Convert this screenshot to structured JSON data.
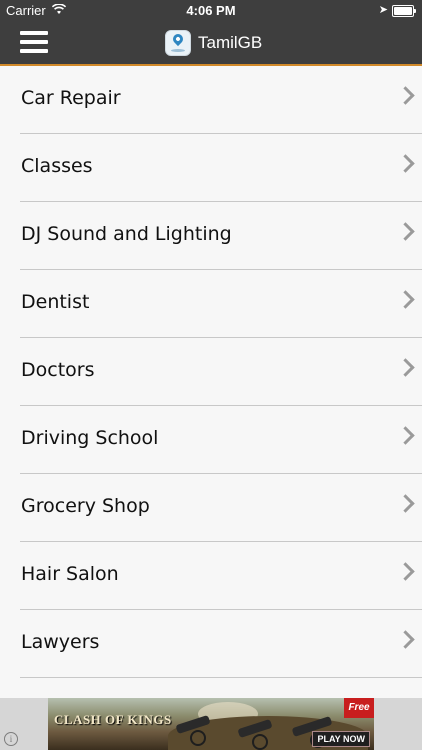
{
  "status_bar": {
    "carrier": "Carrier",
    "time": "4:06 PM",
    "wifi_icon": "wifi-icon",
    "location_icon": "location-arrow-icon",
    "battery_icon": "battery-icon"
  },
  "nav_bar": {
    "menu_icon": "hamburger-menu-icon",
    "logo_icon": "tamilgb-logo",
    "title": "TamilGB",
    "accent_color": "#d28a2a",
    "background_color": "#3e3e3e"
  },
  "categories": [
    {
      "label": "Car Repair"
    },
    {
      "label": "Classes"
    },
    {
      "label": "DJ Sound and Lighting"
    },
    {
      "label": "Dentist"
    },
    {
      "label": "Doctors"
    },
    {
      "label": "Driving School"
    },
    {
      "label": "Grocery Shop"
    },
    {
      "label": "Hair Salon"
    },
    {
      "label": "Lawyers"
    }
  ],
  "ad": {
    "info_label": "i",
    "title": "CLASH OF KINGS",
    "badge": "Free",
    "cta": "PLAY NOW"
  }
}
